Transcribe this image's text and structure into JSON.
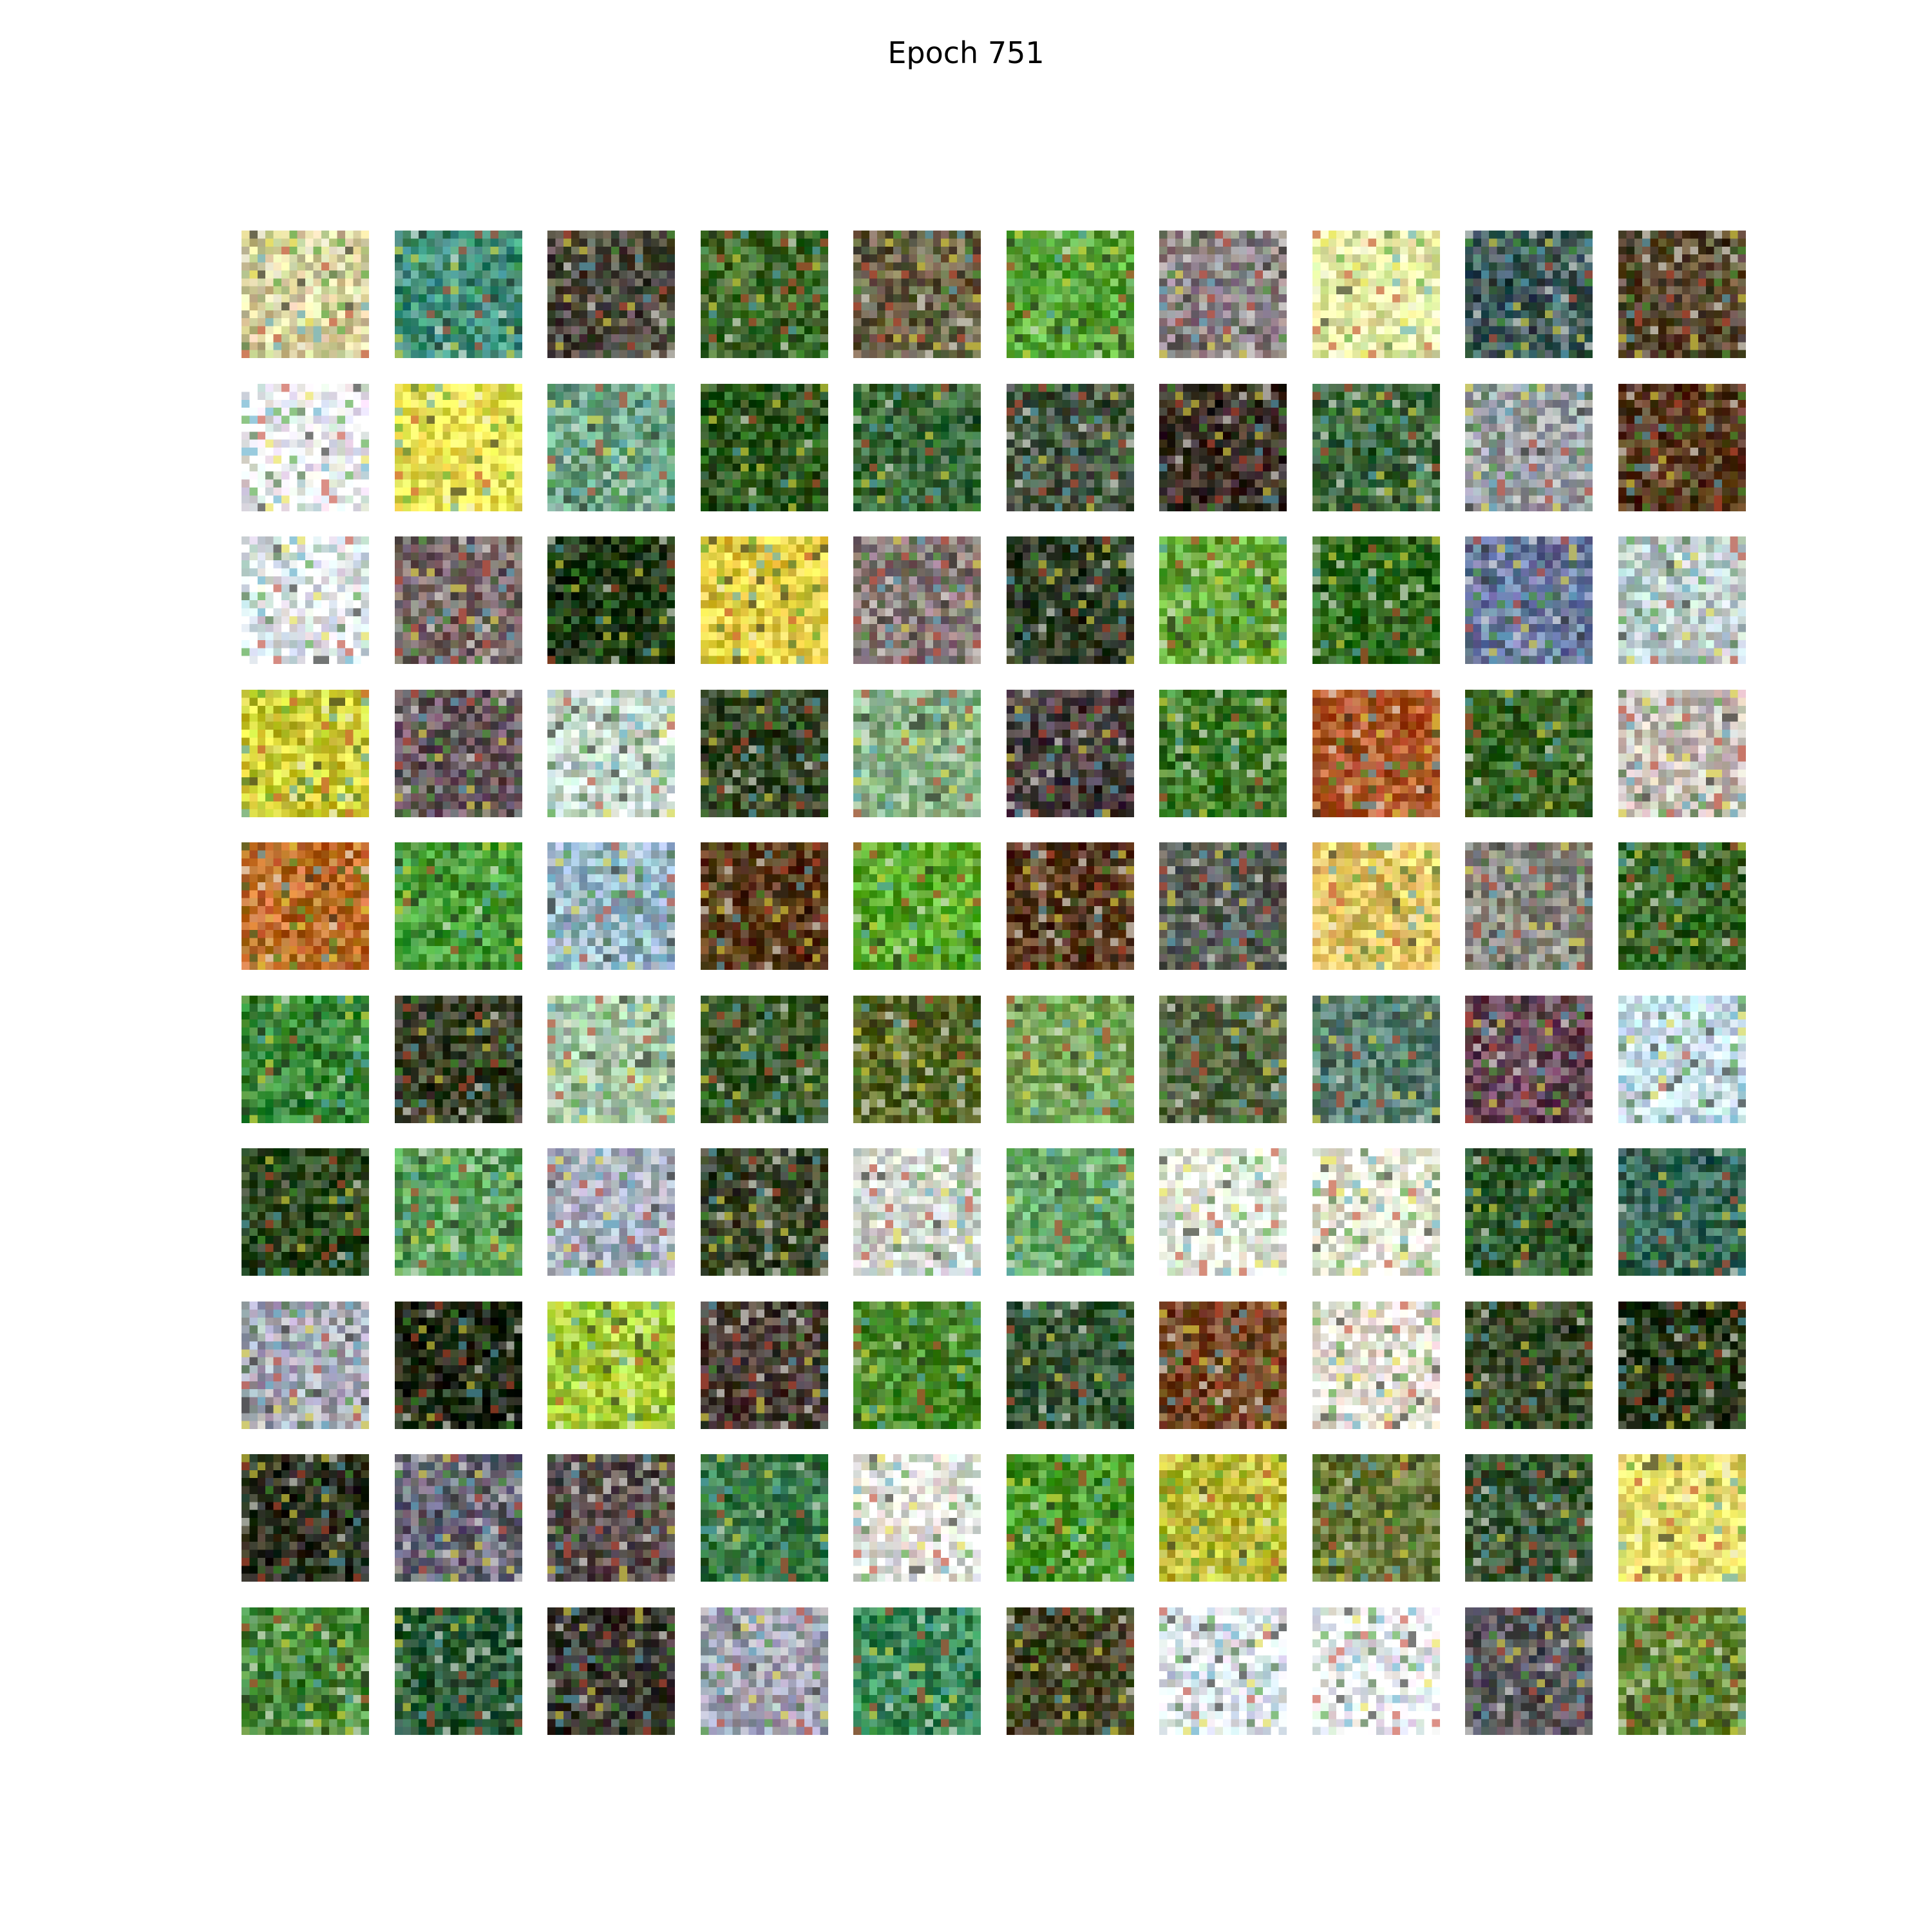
{
  "title": "Epoch 751",
  "grid": {
    "rows": 10,
    "cols": 10,
    "tiles": [
      [
        "#d8d2a0",
        "#3f8f7a",
        "#4f4a3f",
        "#3f6a2c",
        "#6a6045",
        "#5aa63a",
        "#8e8488",
        "#e8f0a8",
        "#3f5a5a",
        "#5a4a32"
      ],
      [
        "#f2f4f8",
        "#f0e85a",
        "#6fa88a",
        "#2f5a1f",
        "#3a6a3a",
        "#4a5a45",
        "#3a3028",
        "#3f6a3f",
        "#9aa0a6",
        "#5a3a1f"
      ],
      [
        "#e4ecf0",
        "#7a6a6a",
        "#1f3a14",
        "#e8d048",
        "#8a7a78",
        "#2f3f2a",
        "#6aaa3a",
        "#2f6a1f",
        "#6a7aa0",
        "#c0d0d0"
      ],
      [
        "#d0d03a",
        "#6a5a60",
        "#c8dcd0",
        "#3a4a2a",
        "#8ab48a",
        "#4a4040",
        "#3f7a2a",
        "#b05a2a",
        "#3f6a2a",
        "#c8c0b8"
      ],
      [
        "#c0702a",
        "#4aa03a",
        "#9ab8c8",
        "#5a3a1a",
        "#5aaa2a",
        "#5a3a20",
        "#5a6058",
        "#e8c86a",
        "#8a8a80",
        "#3a6a2a"
      ],
      [
        "#3a8a3a",
        "#3a4028",
        "#a8c8a8",
        "#3a5a2a",
        "#5a6a2a",
        "#7aa85a",
        "#5a6a48",
        "#5a8070",
        "#6a4a5a",
        "#c8e0ec"
      ],
      [
        "#2f4a1f",
        "#5aa05a",
        "#a8b0c0",
        "#3f4a2f",
        "#d0d8d0",
        "#6aa86a",
        "#e8f0e0",
        "#e8ecd8",
        "#2f5a2f",
        "#3a6a5a"
      ],
      [
        "#a8aab8",
        "#1f2a14",
        "#aad03a",
        "#4a3f38",
        "#4a8a2a",
        "#3a5a3a",
        "#7a4a28",
        "#eae4d8",
        "#3a4a2a",
        "#2a3a1a"
      ],
      [
        "#2a3020",
        "#6a6878",
        "#5a5050",
        "#3a7a4a",
        "#e8e8e0",
        "#4a9a2a",
        "#c0c03a",
        "#6a7a3a",
        "#3f5a3a",
        "#e8e070"
      ],
      [
        "#4a8a3a",
        "#2a5a3a",
        "#3a3830",
        "#a8a8b8",
        "#3a8a5a",
        "#4a4a2a",
        "#e0e8f0",
        "#f4f6fa",
        "#5a5a60",
        "#6a8a3a"
      ]
    ]
  }
}
